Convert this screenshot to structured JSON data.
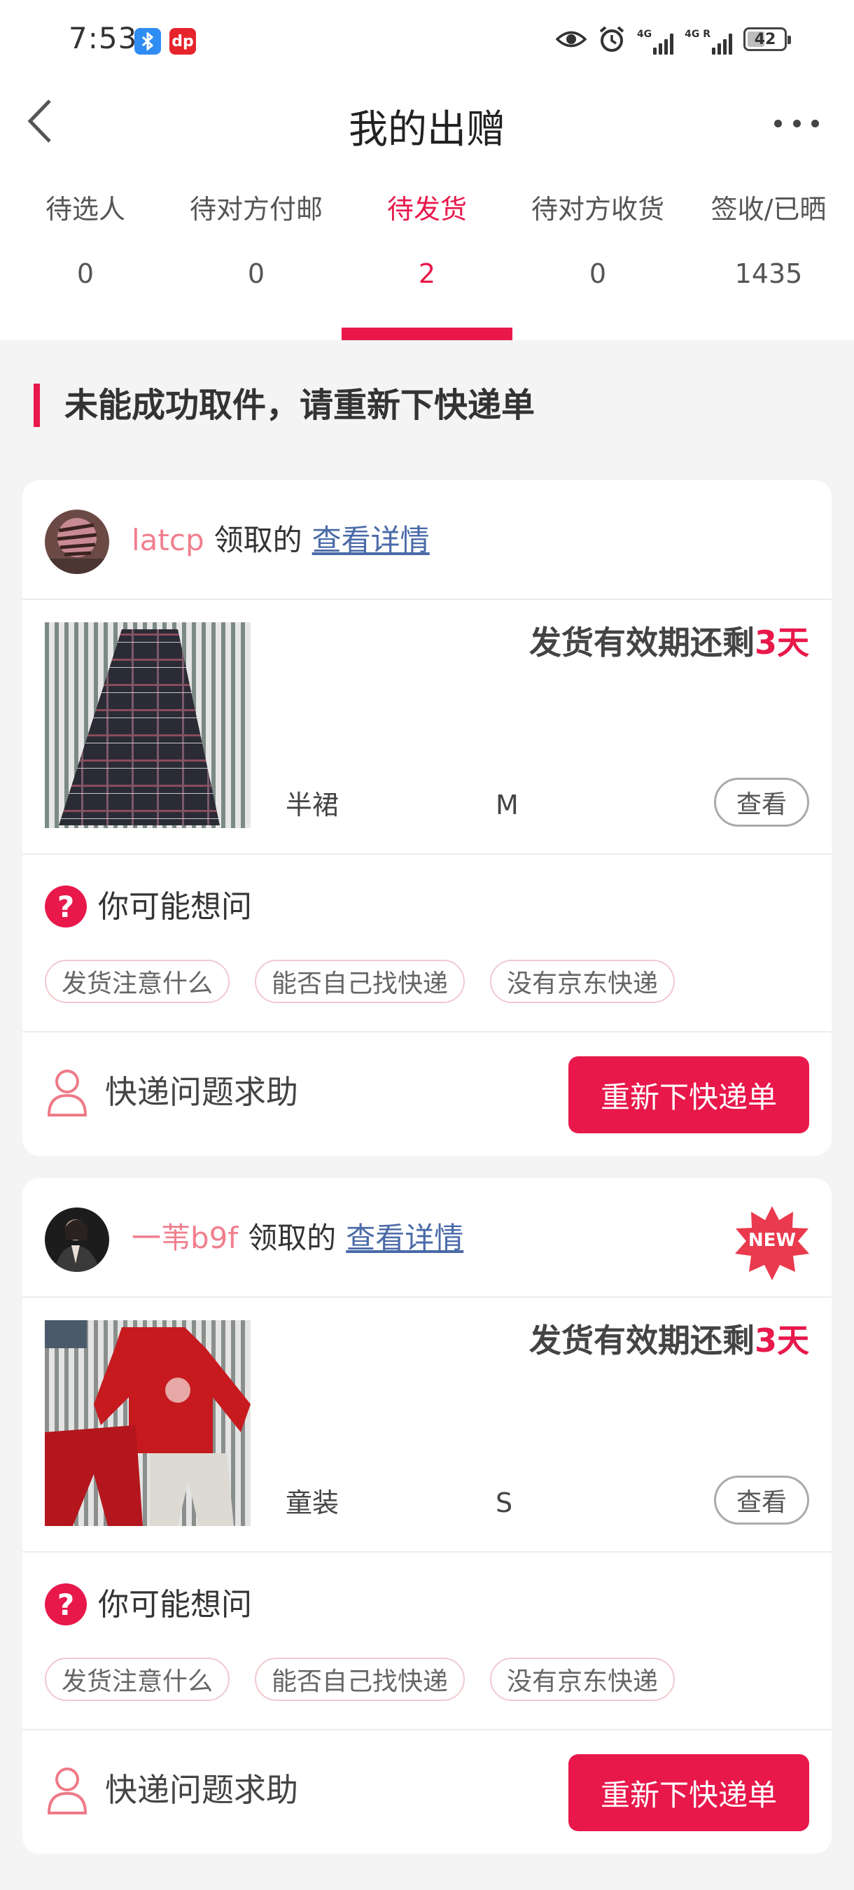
{
  "status_bar": {
    "time": "7:53",
    "app_icon_1": "bluetooth-app-icon",
    "app_icon_2": "red-app-icon",
    "app_icon_2_text": "dp",
    "network_1": "4G",
    "network_2": "4G R",
    "battery": "42"
  },
  "header": {
    "title": "我的出赠"
  },
  "tabs": [
    {
      "label": "待选人",
      "count": "0"
    },
    {
      "label": "待对方付邮",
      "count": "0"
    },
    {
      "label": "待发货",
      "count": "2"
    },
    {
      "label": "待对方收货",
      "count": "0"
    },
    {
      "label": "签收/已晒",
      "count": "1435"
    }
  ],
  "section": {
    "title": "未能成功取件，请重新下快递单"
  },
  "cards": [
    {
      "username": "latcp",
      "claimed_text": "领取的",
      "detail_link": "查看详情",
      "deadline_prefix": "发货有效期还剩",
      "deadline_days": "3天",
      "item_name": "半裙",
      "item_size": "M",
      "view_label": "查看",
      "faq_icon": "?",
      "faq_title": "你可能想问",
      "chips": [
        "发货注意什么",
        "能否自己找快递",
        "没有京东快递"
      ],
      "help_text": "快递问题求助",
      "reorder_label": "重新下快递单"
    },
    {
      "username": "一苇b9f",
      "claimed_text": "领取的",
      "detail_link": "查看详情",
      "badge": "NEW",
      "deadline_prefix": "发货有效期还剩",
      "deadline_days": "3天",
      "item_name": "童装",
      "item_size": "S",
      "view_label": "查看",
      "faq_icon": "?",
      "faq_title": "你可能想问",
      "chips": [
        "发货注意什么",
        "能否自己找快递",
        "没有京东快递"
      ],
      "help_text": "快递问题求助",
      "reorder_label": "重新下快递单"
    }
  ],
  "colors": {
    "accent": "#e8184b",
    "username": "#f07f8e",
    "link": "#4a6aa8",
    "background": "#f4f4f4"
  }
}
